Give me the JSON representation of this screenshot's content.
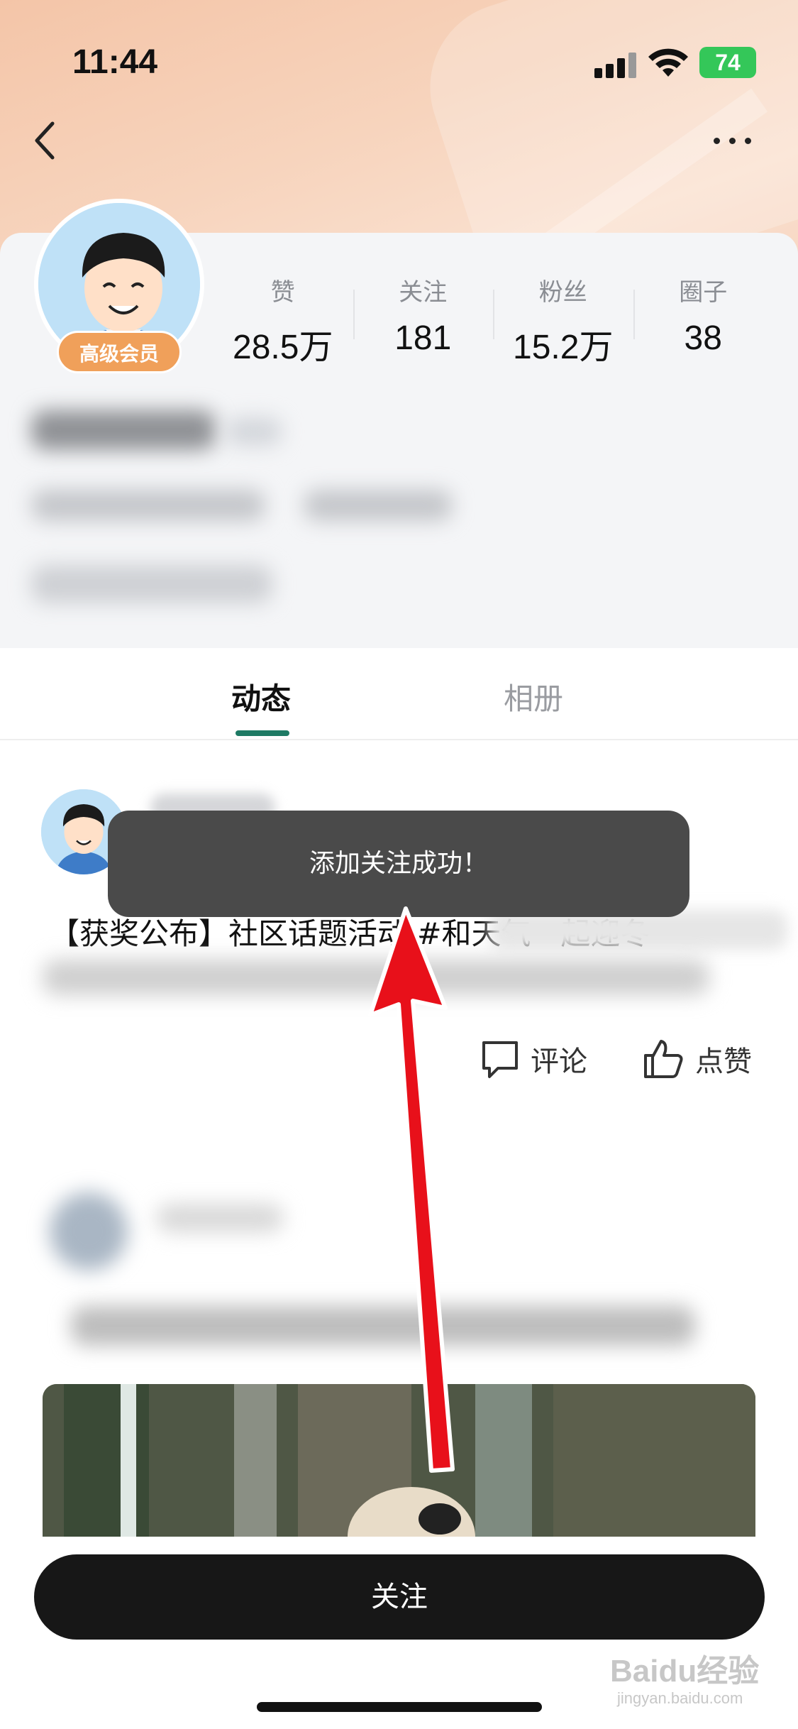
{
  "status_bar": {
    "time": "11:44",
    "battery": "74"
  },
  "nav": {
    "back_icon": "chevron-left-icon",
    "more_icon": "more-dots-icon"
  },
  "profile": {
    "member_badge": "高级会员",
    "stats": [
      {
        "label": "赞",
        "value": "28.5万"
      },
      {
        "label": "关注",
        "value": "181"
      },
      {
        "label": "粉丝",
        "value": "15.2万"
      },
      {
        "label": "圈子",
        "value": "38"
      }
    ]
  },
  "tabs": [
    {
      "label": "动态",
      "active": true
    },
    {
      "label": "相册",
      "active": false
    }
  ],
  "post": {
    "text": "【获奖公布】社区话题活动 #和天气一起迎冬",
    "comment_label": "评论",
    "like_label": "点赞"
  },
  "toast": {
    "message": "添加关注成功！"
  },
  "follow_button": {
    "label": "关注"
  },
  "watermark": {
    "text": "Baidu经验",
    "sub": "jingyan.baidu.com"
  },
  "colors": {
    "accent": "#1e7a64",
    "toast_bg": "#4a4a4a",
    "button_bg": "#171717",
    "badge": "#f0a05a",
    "arrow": "#e8101a"
  }
}
